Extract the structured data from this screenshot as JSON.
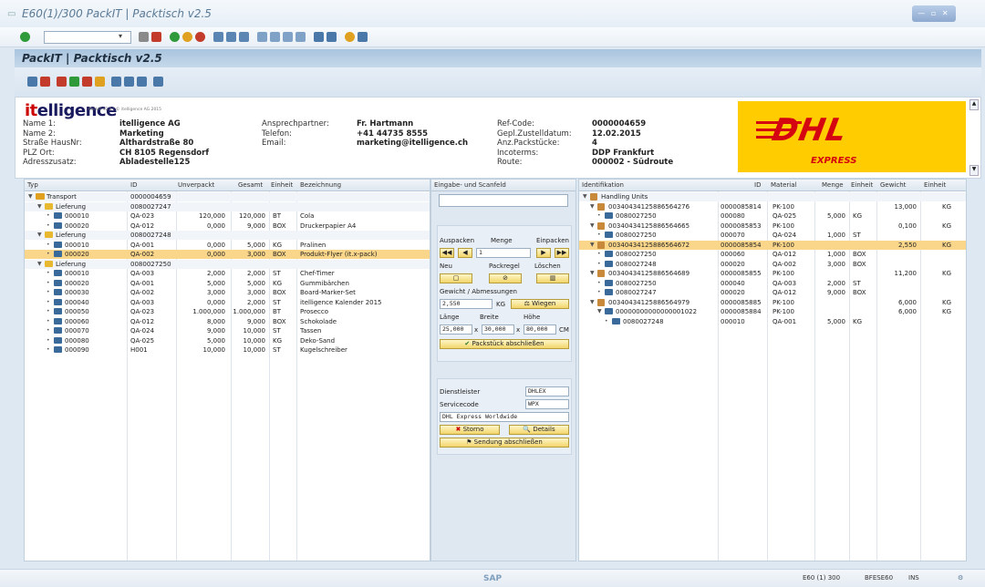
{
  "window": {
    "title": "E60(1)/300 PackIT | Packtisch v2.5"
  },
  "page": {
    "title": "PackIT | Packtisch v2.5"
  },
  "header": {
    "logo": "itelligence",
    "logo_sub": "PackIT v2.5 | © itelligence AG 2015",
    "fields_col1": [
      {
        "label": "Name 1:",
        "value": "itelligence AG"
      },
      {
        "label": "Name 2:",
        "value": "Marketing"
      },
      {
        "label": "Straße HausNr:",
        "value": "Althardstraße 80"
      },
      {
        "label": "PLZ Ort:",
        "value": "CH 8105 Regensdorf"
      },
      {
        "label": "Adresszusatz:",
        "value": "Abladestelle125"
      }
    ],
    "fields_col2": [
      {
        "label": "Ansprechpartner:",
        "value": "Fr. Hartmann"
      },
      {
        "label": "Telefon:",
        "value": "+41 44735 8555"
      },
      {
        "label": "Email:",
        "value": "marketing@itelligence.ch"
      }
    ],
    "fields_col3": [
      {
        "label": "Ref-Code:",
        "value": "0000004659"
      },
      {
        "label": "Gepl.Zustelldatum:",
        "value": "12.02.2015"
      },
      {
        "label": "Anz.Packstücke:",
        "value": "4"
      },
      {
        "label": "Incoterms:",
        "value": "DDP Frankfurt"
      },
      {
        "label": "Route:",
        "value": "000002 - Südroute"
      }
    ],
    "carrier_logo": "DHL",
    "carrier_sub": "EXPRESS"
  },
  "left_table": {
    "columns": [
      "Typ",
      "ID",
      "Unverpackt",
      "Gesamt",
      "Einheit",
      "Bezeichnung"
    ],
    "rows": [
      {
        "typ": "Transport",
        "id": "0000004659",
        "unv": "",
        "ges": "",
        "einh": "",
        "bez": "",
        "level": 0,
        "kind": "grp"
      },
      {
        "typ": "Lieferung",
        "id": "0080027247",
        "unv": "",
        "ges": "",
        "einh": "",
        "bez": "",
        "level": 1,
        "kind": "grp"
      },
      {
        "typ": "000010",
        "id": "QA-023",
        "unv": "120,000",
        "ges": "120,000",
        "einh": "BT",
        "bez": "Cola",
        "level": 2,
        "kind": ""
      },
      {
        "typ": "000020",
        "id": "QA-012",
        "unv": "0,000",
        "ges": "9,000",
        "einh": "BOX",
        "bez": "Druckerpapier A4",
        "level": 2,
        "kind": ""
      },
      {
        "typ": "Lieferung",
        "id": "0080027248",
        "unv": "",
        "ges": "",
        "einh": "",
        "bez": "",
        "level": 1,
        "kind": "grp"
      },
      {
        "typ": "000010",
        "id": "QA-001",
        "unv": "0,000",
        "ges": "5,000",
        "einh": "KG",
        "bez": "Pralinen",
        "level": 2,
        "kind": ""
      },
      {
        "typ": "000020",
        "id": "QA-002",
        "unv": "0,000",
        "ges": "3,000",
        "einh": "BOX",
        "bez": "Produkt-Flyer (it.x-pack)",
        "level": 2,
        "kind": "hl"
      },
      {
        "typ": "Lieferung",
        "id": "0080027250",
        "unv": "",
        "ges": "",
        "einh": "",
        "bez": "",
        "level": 1,
        "kind": "grp"
      },
      {
        "typ": "000010",
        "id": "QA-003",
        "unv": "2,000",
        "ges": "2,000",
        "einh": "ST",
        "bez": "Chef-Timer",
        "level": 2,
        "kind": ""
      },
      {
        "typ": "000020",
        "id": "QA-001",
        "unv": "5,000",
        "ges": "5,000",
        "einh": "KG",
        "bez": "Gummibärchen",
        "level": 2,
        "kind": ""
      },
      {
        "typ": "000030",
        "id": "QA-002",
        "unv": "3,000",
        "ges": "3,000",
        "einh": "BOX",
        "bez": "Board-Marker-Set",
        "level": 2,
        "kind": ""
      },
      {
        "typ": "000040",
        "id": "QA-003",
        "unv": "0,000",
        "ges": "2,000",
        "einh": "ST",
        "bez": "itelligence Kalender 2015",
        "level": 2,
        "kind": ""
      },
      {
        "typ": "000050",
        "id": "QA-023",
        "unv": "1.000,000",
        "ges": "1.000,000",
        "einh": "BT",
        "bez": "Prosecco",
        "level": 2,
        "kind": ""
      },
      {
        "typ": "000060",
        "id": "QA-012",
        "unv": "8,000",
        "ges": "9,000",
        "einh": "BOX",
        "bez": "Schokolade",
        "level": 2,
        "kind": ""
      },
      {
        "typ": "000070",
        "id": "QA-024",
        "unv": "9,000",
        "ges": "10,000",
        "einh": "ST",
        "bez": "Tassen",
        "level": 2,
        "kind": ""
      },
      {
        "typ": "000080",
        "id": "QA-025",
        "unv": "5,000",
        "ges": "10,000",
        "einh": "KG",
        "bez": "Deko-Sand",
        "level": 2,
        "kind": ""
      },
      {
        "typ": "000090",
        "id": "H001",
        "unv": "10,000",
        "ges": "10,000",
        "einh": "ST",
        "bez": "Kugelschreiber",
        "level": 2,
        "kind": ""
      }
    ]
  },
  "mid": {
    "scan_title": "Eingabe- und Scanfeld",
    "auspacken": "Auspacken",
    "menge": "Menge",
    "einpacken": "Einpacken",
    "menge_value": "1",
    "neu": "Neu",
    "packregel": "Packregel",
    "loeschen": "Löschen",
    "gewicht_label": "Gewicht / Abmessungen",
    "gewicht_value": "2,550",
    "gewicht_unit": "KG",
    "wiegen": "Wiegen",
    "laenge": "Länge",
    "breite": "Breite",
    "hoehe": "Höhe",
    "l_val": "25,000",
    "b_val": "30,000",
    "h_val": "80,000",
    "dim_unit": "CM",
    "x": "x",
    "abschliessen": "Packstück abschließen",
    "dienstleister_label": "Dienstleister",
    "dienstleister": "DHLEX",
    "servicecode_label": "Servicecode",
    "servicecode": "WPX",
    "service_desc": "DHL Express Worldwide",
    "storno": "Storno",
    "details": "Details",
    "sendung": "Sendung abschließen"
  },
  "right_table": {
    "columns": [
      "Identifikation",
      "ID",
      "Material",
      "Menge",
      "Einheit",
      "Gewicht",
      "Einheit"
    ],
    "rows": [
      {
        "ident": "Handling Units",
        "id": "",
        "mat": "",
        "menge": "",
        "einh": "",
        "gew": "",
        "gein": "",
        "level": 0,
        "kind": "grp"
      },
      {
        "ident": "00340434125886564276",
        "id": "0000085814",
        "mat": "PK-100",
        "menge": "",
        "einh": "",
        "gew": "13,000",
        "gein": "KG",
        "level": 1,
        "kind": ""
      },
      {
        "ident": "0080027250",
        "id": "000080",
        "mat": "QA-025",
        "menge": "5,000",
        "einh": "KG",
        "gew": "",
        "gein": "",
        "level": 2,
        "kind": ""
      },
      {
        "ident": "00340434125886564665",
        "id": "0000085853",
        "mat": "PK-100",
        "menge": "",
        "einh": "",
        "gew": "0,100",
        "gein": "KG",
        "level": 1,
        "kind": ""
      },
      {
        "ident": "0080027250",
        "id": "000070",
        "mat": "QA-024",
        "menge": "1,000",
        "einh": "ST",
        "gew": "",
        "gein": "",
        "level": 2,
        "kind": ""
      },
      {
        "ident": "00340434125886564672",
        "id": "0000085854",
        "mat": "PK-100",
        "menge": "",
        "einh": "",
        "gew": "2,550",
        "gein": "KG",
        "level": 1,
        "kind": "hl"
      },
      {
        "ident": "0080027250",
        "id": "000060",
        "mat": "QA-012",
        "menge": "1,000",
        "einh": "BOX",
        "gew": "",
        "gein": "",
        "level": 2,
        "kind": ""
      },
      {
        "ident": "0080027248",
        "id": "000020",
        "mat": "QA-002",
        "menge": "3,000",
        "einh": "BOX",
        "gew": "",
        "gein": "",
        "level": 2,
        "kind": ""
      },
      {
        "ident": "00340434125886564689",
        "id": "0000085855",
        "mat": "PK-100",
        "menge": "",
        "einh": "",
        "gew": "11,200",
        "gein": "KG",
        "level": 1,
        "kind": ""
      },
      {
        "ident": "0080027250",
        "id": "000040",
        "mat": "QA-003",
        "menge": "2,000",
        "einh": "ST",
        "gew": "",
        "gein": "",
        "level": 2,
        "kind": ""
      },
      {
        "ident": "0080027247",
        "id": "000020",
        "mat": "QA-012",
        "menge": "9,000",
        "einh": "BOX",
        "gew": "",
        "gein": "",
        "level": 2,
        "kind": ""
      },
      {
        "ident": "00340434125886564979",
        "id": "0000085885",
        "mat": "PK-100",
        "menge": "",
        "einh": "",
        "gew": "6,000",
        "gein": "KG",
        "level": 1,
        "kind": ""
      },
      {
        "ident": "00000000000000001022",
        "id": "0000085884",
        "mat": "PK-100",
        "menge": "",
        "einh": "",
        "gew": "6,000",
        "gein": "KG",
        "level": 2,
        "kind": ""
      },
      {
        "ident": "0080027248",
        "id": "000010",
        "mat": "QA-001",
        "menge": "5,000",
        "einh": "KG",
        "gew": "",
        "gein": "",
        "level": 3,
        "kind": ""
      }
    ]
  },
  "statusbar": {
    "system": "E60 (1) 300",
    "server": "BFESE60",
    "mode": "INS"
  },
  "colors": {
    "highlight": "#fad68a",
    "accent": "#fc0",
    "dhl_red": "#d40511"
  }
}
